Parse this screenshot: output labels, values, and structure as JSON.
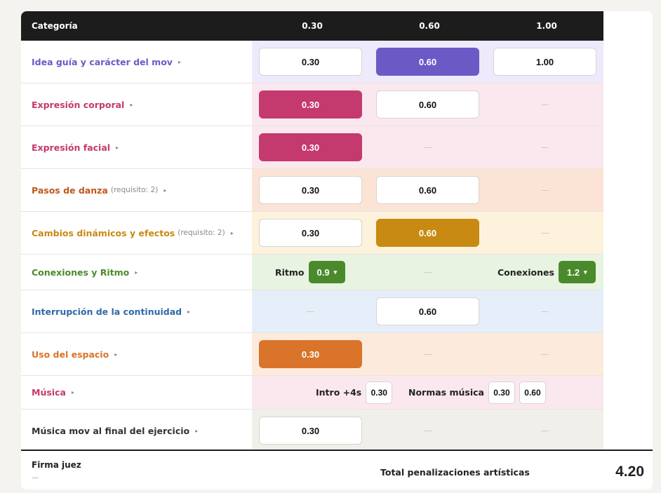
{
  "header": {
    "category": "Categoría",
    "col1": "0.30",
    "col2": "0.60",
    "col3": "1.00"
  },
  "dash": "—",
  "rows": {
    "idea": {
      "label": "Idea guía y carácter del mov",
      "color": "#6b5ac6",
      "bg": "#eeeafb",
      "v1": "0.30",
      "v2": "0.60",
      "v3": "1.00",
      "selected": "0.60"
    },
    "corporal": {
      "label": "Expresión corporal",
      "color": "#c4396e",
      "bg": "#fbe8ef",
      "v1": "0.30",
      "v2": "0.60",
      "selected": "0.30"
    },
    "facial": {
      "label": "Expresión facial",
      "color": "#c4396e",
      "bg": "#fbe8ef",
      "v1": "0.30",
      "selected": "0.30"
    },
    "pasos": {
      "label": "Pasos de danza",
      "req": "(requisito: 2)",
      "color": "#c0571c",
      "bg": "#fbe4d6",
      "v1": "0.30",
      "v2": "0.60"
    },
    "cambios": {
      "label": "Cambios dinámicos y efectos",
      "req": "(requisito: 2)",
      "color": "#c88a12",
      "bg": "#fdf2dc",
      "v1": "0.30",
      "v2": "0.60",
      "selected": "0.60"
    },
    "conexiones": {
      "label": "Conexiones y Ritmo",
      "color": "#4a8a2c",
      "bg": "#e9f3e2",
      "ritmo_label": "Ritmo",
      "ritmo_value": "0.9",
      "conexiones_label": "Conexiones",
      "conexiones_value": "1.2",
      "chev": "▾"
    },
    "interrupcion": {
      "label": "Interrupción de la continuidad",
      "color": "#2f6aa8",
      "bg": "#e6eefa",
      "v2": "0.60"
    },
    "espacio": {
      "label": "Uso del espacio",
      "color": "#d9742a",
      "bg": "#fcebdc",
      "v1": "0.30",
      "selected": "0.30"
    },
    "musica": {
      "label": "Música",
      "color": "#c4396e",
      "bg": "#fbe8ef",
      "intro_label": "Intro +4s",
      "intro_value": "0.30",
      "normas_label": "Normas música",
      "normas_v1": "0.30",
      "normas_v2": "0.60"
    },
    "musica_mov": {
      "label": "Música mov al final del ejercicio",
      "color": "#333333",
      "bg": "#f1efe9",
      "v1": "0.30"
    }
  },
  "footer": {
    "signature_label": "Firma juez",
    "signature_value": "—",
    "total_label": "Total penalizaciones artísticas",
    "total_value": "4.20"
  }
}
